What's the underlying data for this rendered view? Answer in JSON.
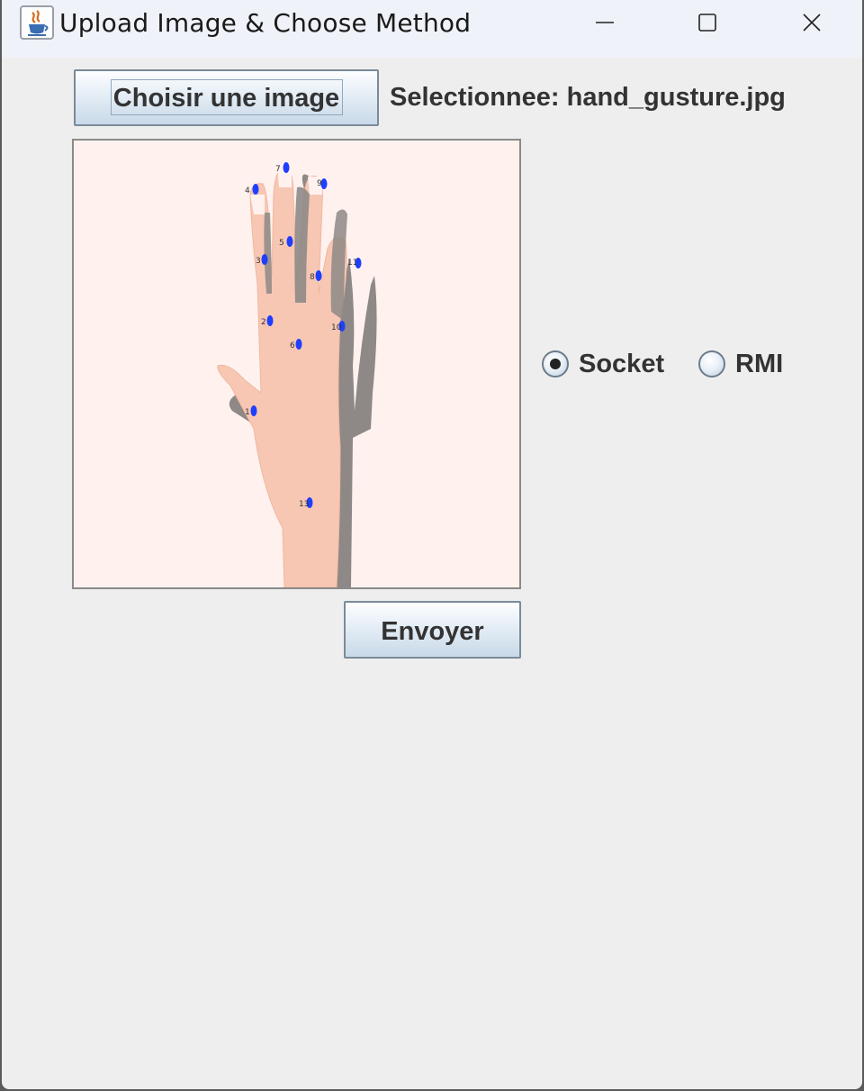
{
  "window": {
    "title": "Upload Image & Choose Method",
    "app_icon": "java-coffee-cup-icon",
    "controls": [
      "minimize-icon",
      "maximize-icon",
      "close-icon"
    ]
  },
  "toolbar": {
    "choose_label": "Choisir une image",
    "selected_text": "Selectionnee: hand_gusture.jpg"
  },
  "preview": {
    "image": "hand-gesture-landmarks-image",
    "landmark_labels": [
      "1",
      "2",
      "3",
      "4",
      "5",
      "6",
      "7",
      "8",
      "9",
      "10",
      "11",
      "12",
      "13",
      "14"
    ],
    "landmark_color": "#1f3fff"
  },
  "method": {
    "options": [
      {
        "label": "Socket",
        "selected": true
      },
      {
        "label": "RMI",
        "selected": false
      }
    ]
  },
  "actions": {
    "send_label": "Envoyer"
  },
  "colors": {
    "window_bg": "#eeeeee",
    "titlebar_bg": "#eff2f8",
    "preview_bg": "#fff1ee",
    "button_border": "#7a8a99"
  }
}
